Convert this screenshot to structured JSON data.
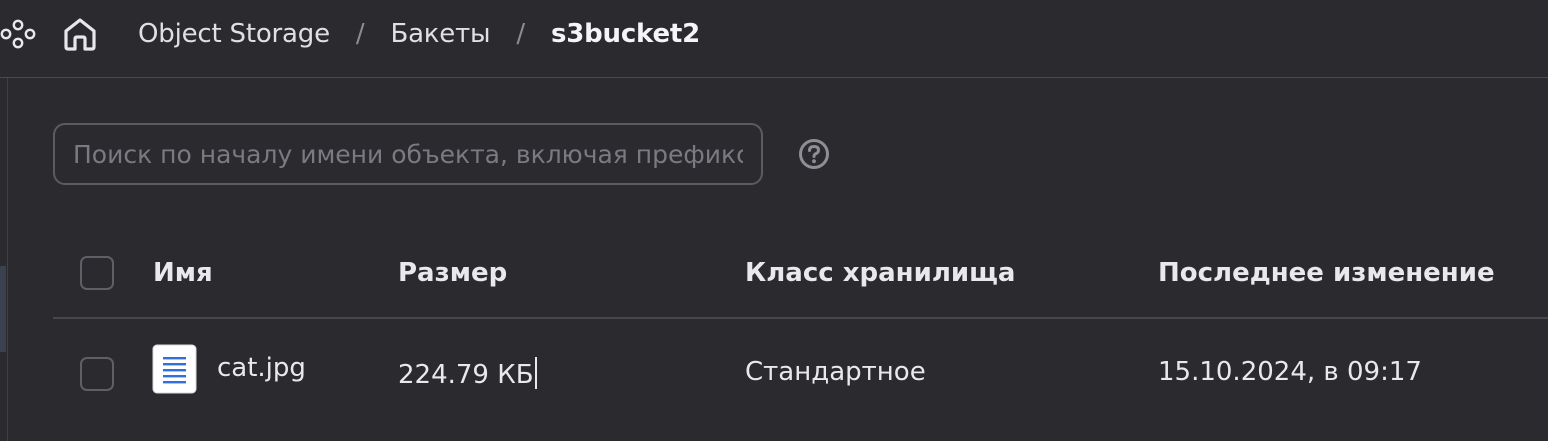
{
  "header": {
    "services_icon": "services-grid-icon",
    "home_icon": "home-icon",
    "breadcrumb": [
      {
        "label": "Object Storage"
      },
      {
        "label": "Бакеты"
      },
      {
        "label": "s3bucket2"
      }
    ],
    "separator": "/"
  },
  "search": {
    "placeholder": "Поиск по началу имени объекта, включая префикс",
    "value": "",
    "help_icon": "question-circle-icon"
  },
  "table": {
    "columns": [
      "Имя",
      "Размер",
      "Класс хранилища",
      "Последнее изменение"
    ],
    "rows": [
      {
        "name": "cat.jpg",
        "icon": "file-document-icon",
        "size": "224.79 КБ",
        "storage_class": "Стандартное",
        "modified": "15.10.2024, в 09:17"
      }
    ]
  },
  "colors": {
    "background": "#2a2a2f",
    "text": "#e8e8ea",
    "border": "#5b5b61",
    "file_icon_accent": "#2f6fe0"
  }
}
